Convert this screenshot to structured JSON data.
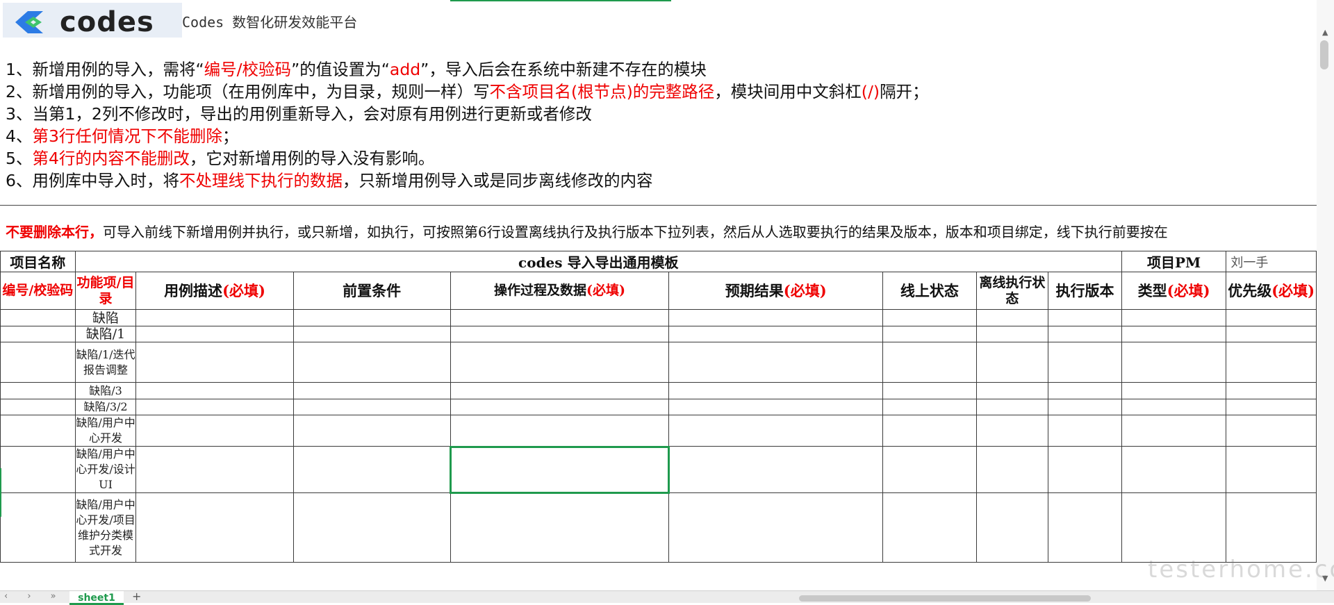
{
  "header": {
    "logo_text": "codes",
    "platform_title": "Codes 数智化研发效能平台"
  },
  "notes": [
    [
      {
        "t": "1、新增用例的导入，需将“"
      },
      {
        "t": "编号/校验码",
        "red": true
      },
      {
        "t": "”的值设置为“"
      },
      {
        "t": "add",
        "red": true
      },
      {
        "t": "”，导入后会在系统中新建不存在的模块"
      }
    ],
    [
      {
        "t": "2、新增用例的导入，功能项（在用例库中，为目录，规则一样）写"
      },
      {
        "t": "不含项目名(根节点)的完整路径",
        "red": true
      },
      {
        "t": "，模块间用中文斜杠"
      },
      {
        "t": "(/)",
        "red": true
      },
      {
        "t": "隔开；"
      }
    ],
    [
      {
        "t": "3、当第1，2列不修改时，导出的用例重新导入，会对原有用例进行更新或者修改"
      }
    ],
    [
      {
        "t": "4、"
      },
      {
        "t": "第3行任何情况下不能删除",
        "red": true
      },
      {
        "t": "；"
      }
    ],
    [
      {
        "t": "5、"
      },
      {
        "t": "第4行的内容不能删改",
        "red": true
      },
      {
        "t": "，它对新增用例的导入没有影响。"
      }
    ],
    [
      {
        "t": "6、用例库中导入时，将"
      },
      {
        "t": "不处理线下执行的数据",
        "red": true
      },
      {
        "t": "，只新增用例导入或是同步离线修改的内容"
      }
    ]
  ],
  "warning": {
    "red_part": "不要删除本行，",
    "rest": "可导入前线下新增用例并执行，或只新增，如执行，可按照第6行设置离线执行及执行版本下拉列表，然后从人选取要执行的结果及版本，版本和项目绑定，线下执行前要按在"
  },
  "sheet": {
    "project_name_label": "项目名称",
    "template_title": "codes 导入导出通用模板",
    "pm_label": "项目PM",
    "pm_value": "刘一手",
    "columns": [
      {
        "label": "编号/校验码",
        "all_red": true
      },
      {
        "label": "功能项/目录",
        "all_red": true
      },
      {
        "label": "用例描述",
        "req": "(必填)"
      },
      {
        "label": "前置条件"
      },
      {
        "label": "操作过程及数据",
        "req": "(必填)"
      },
      {
        "label": "预期结果",
        "req": "(必填)"
      },
      {
        "label": "线上状态"
      },
      {
        "label": "离线执行状态"
      },
      {
        "label": "执行版本"
      },
      {
        "label": "类型",
        "req": "(必填)"
      },
      {
        "label": "优先级",
        "req": "(必填)"
      }
    ],
    "paths": [
      "缺陷",
      "缺陷/1",
      "缺陷/1/迭代报告调整",
      "缺陷/3",
      "缺陷/3/2",
      "缺陷/用户中心开发",
      "缺陷/用户中心开发/设计UI",
      "缺陷/用户中心开发/项目维护分类模式开发"
    ]
  },
  "footer": {
    "nav_arrows": "‹ › »",
    "sheet_tab": "sheet1",
    "add_tab": "+"
  },
  "watermark": "testerhome.com",
  "colors": {
    "accent_green": "#1f9a4d",
    "required_red": "#ef0000",
    "logo_blue": "#2c7be5"
  }
}
